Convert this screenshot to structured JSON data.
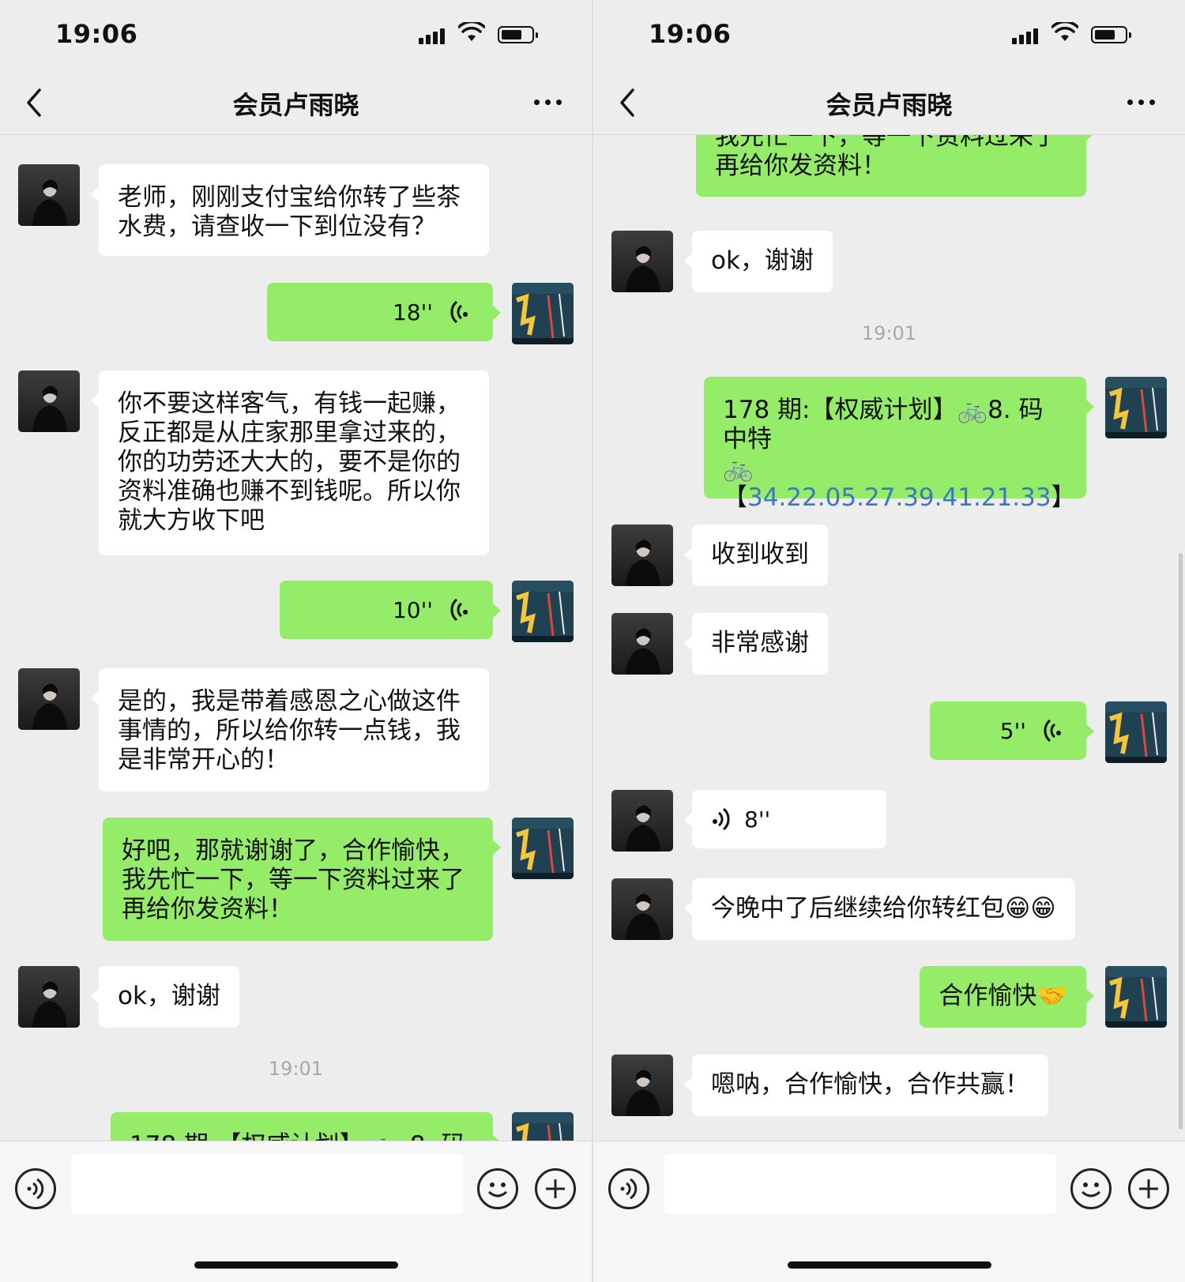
{
  "colors": {
    "sent_bubble": "#95ec69",
    "received_bubble": "#ffffff",
    "background": "#ededed",
    "link": "#3a78c2"
  },
  "left": {
    "status": {
      "time": "19:06"
    },
    "nav": {
      "title": "会员卢雨晓"
    },
    "messages": {
      "m1": {
        "sender": "them",
        "lines": [
          "老师，刚刚支付宝给你转了些茶",
          "水费，请查收一下到位没有？"
        ]
      },
      "m2": {
        "sender": "me",
        "voice_duration": "18''"
      },
      "m3": {
        "sender": "them",
        "lines": [
          "你不要这样客气，有钱一起赚，",
          "反正都是从庄家那里拿过来的，",
          "你的功劳还大大的，要不是你的",
          "资料准确也赚不到钱呢。所以你",
          "就大方收下吧"
        ]
      },
      "m4": {
        "sender": "me",
        "voice_duration": "10''"
      },
      "m5": {
        "sender": "them",
        "lines": [
          "是的，我是带着感恩之心做这件",
          "事情的，所以给你转一点钱，我",
          "是非常开心的！"
        ]
      },
      "m6": {
        "sender": "me",
        "lines": [
          "好吧，那就谢谢了，合作愉快，",
          "我先忙一下，等一下资料过来了",
          "再给你发资料！"
        ]
      },
      "m7": {
        "sender": "them",
        "text": "ok，谢谢"
      },
      "timestamp": "19:01",
      "m8_partial": {
        "sender": "me",
        "text": "178 期:【权威计划】 🚲 8. 码中特"
      }
    },
    "input": {
      "placeholder": ""
    }
  },
  "right": {
    "status": {
      "time": "19:06"
    },
    "nav": {
      "title": "会员卢雨晓"
    },
    "messages": {
      "r0_partial": {
        "sender": "me",
        "lines": [
          "我先忙一下，等一下资料过来了",
          "再给你发资料！"
        ]
      },
      "r1": {
        "sender": "them",
        "text": "ok，谢谢"
      },
      "timestamp": "19:01",
      "r2": {
        "sender": "me",
        "line1": "178 期:【权威计划】🚲8. 码中特",
        "line2": "🚲",
        "bracket_open": "【",
        "numbers": "34.22.05.27.39.41.21.33",
        "bracket_close": "】"
      },
      "r3": {
        "sender": "them",
        "text": "收到收到"
      },
      "r4": {
        "sender": "them",
        "text": "非常感谢"
      },
      "r5": {
        "sender": "me",
        "voice_duration": "5''"
      },
      "r6": {
        "sender": "them",
        "voice_duration": "8''"
      },
      "r7": {
        "sender": "them",
        "text": "今晚中了后继续给你转红包😁😁"
      },
      "r8": {
        "sender": "me",
        "text": "合作愉快🤝"
      },
      "r9": {
        "sender": "them",
        "text": "嗯呐，合作愉快，合作共赢！"
      }
    },
    "input": {
      "placeholder": ""
    }
  },
  "icons": {
    "back": "chevron-left-icon",
    "more": "more-dots-icon",
    "voice_input": "voice-input-icon",
    "emoji": "emoji-icon",
    "plus": "plus-icon",
    "voice_wave": "voice-wave-icon"
  }
}
